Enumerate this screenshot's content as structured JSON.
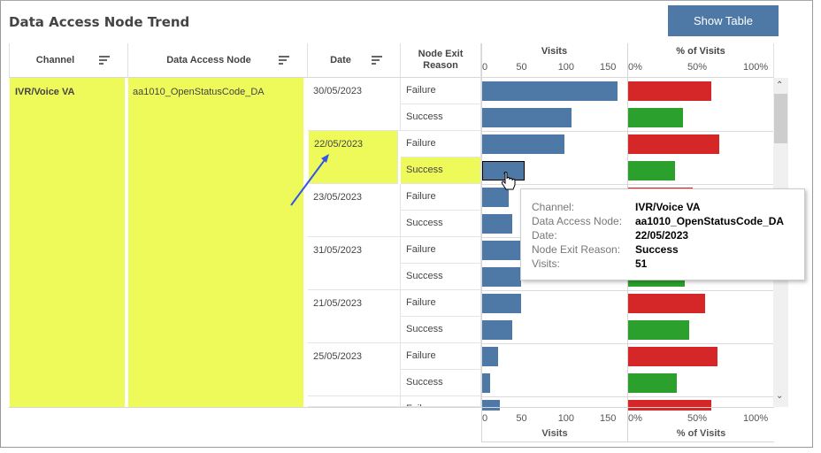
{
  "title": "Data Access Node Trend",
  "show_table_label": "Show Table",
  "headers": {
    "channel": "Channel",
    "node": "Data Access Node",
    "date": "Date",
    "reason": "Node Exit Reason",
    "visits": "Visits",
    "pct": "% of Visits"
  },
  "channel": "IVR/Voice VA",
  "node": "aa1010_OpenStatusCode_DA",
  "colors": {
    "visits": "#4e79a7",
    "failure": "#d62728",
    "success": "#2ca02c",
    "highlight": "#eefa5a"
  },
  "chart_data": {
    "type": "bar",
    "visits_axis": {
      "label": "Visits",
      "ticks": [
        "0",
        "50",
        "100",
        "150"
      ],
      "range": [
        0,
        172
      ]
    },
    "pct_axis": {
      "label": "% of Visits",
      "ticks": [
        "0%",
        "50%",
        "100%"
      ],
      "range": [
        0,
        100
      ]
    },
    "rows": [
      {
        "date": "30/05/2023",
        "reason": "Failure",
        "visits": 162,
        "pct": 60
      },
      {
        "reason": "Success",
        "visits": 107,
        "pct": 40
      },
      {
        "date": "22/05/2023",
        "reason": "Failure",
        "visits": 98,
        "pct": 66
      },
      {
        "reason": "Success",
        "visits": 51,
        "pct": 34,
        "selected": true
      },
      {
        "date": "23/05/2023",
        "reason": "Failure",
        "visits": 32,
        "pct": 47
      },
      {
        "reason": "Success",
        "visits": 36,
        "pct": 53
      },
      {
        "date": "31/05/2023",
        "reason": "Failure",
        "visits": 66,
        "pct": 59
      },
      {
        "reason": "Success",
        "visits": 46,
        "pct": 41
      },
      {
        "date": "21/05/2023",
        "reason": "Failure",
        "visits": 46,
        "pct": 56
      },
      {
        "reason": "Success",
        "visits": 36,
        "pct": 44
      },
      {
        "date": "25/05/2023",
        "reason": "Failure",
        "visits": 19,
        "pct": 65
      },
      {
        "reason": "Success",
        "visits": 10,
        "pct": 35
      },
      {
        "date": "",
        "reason": "Failure",
        "visits": 21,
        "pct": 60
      }
    ]
  },
  "tooltip": [
    {
      "k": "Channel:",
      "v": "IVR/Voice VA"
    },
    {
      "k": "Data Access Node:",
      "v": "aa1010_OpenStatusCode_DA"
    },
    {
      "k": "Date:",
      "v": "22/05/2023"
    },
    {
      "k": "Node Exit Reason:",
      "v": "Success"
    },
    {
      "k": "Visits:",
      "v": "51"
    }
  ]
}
